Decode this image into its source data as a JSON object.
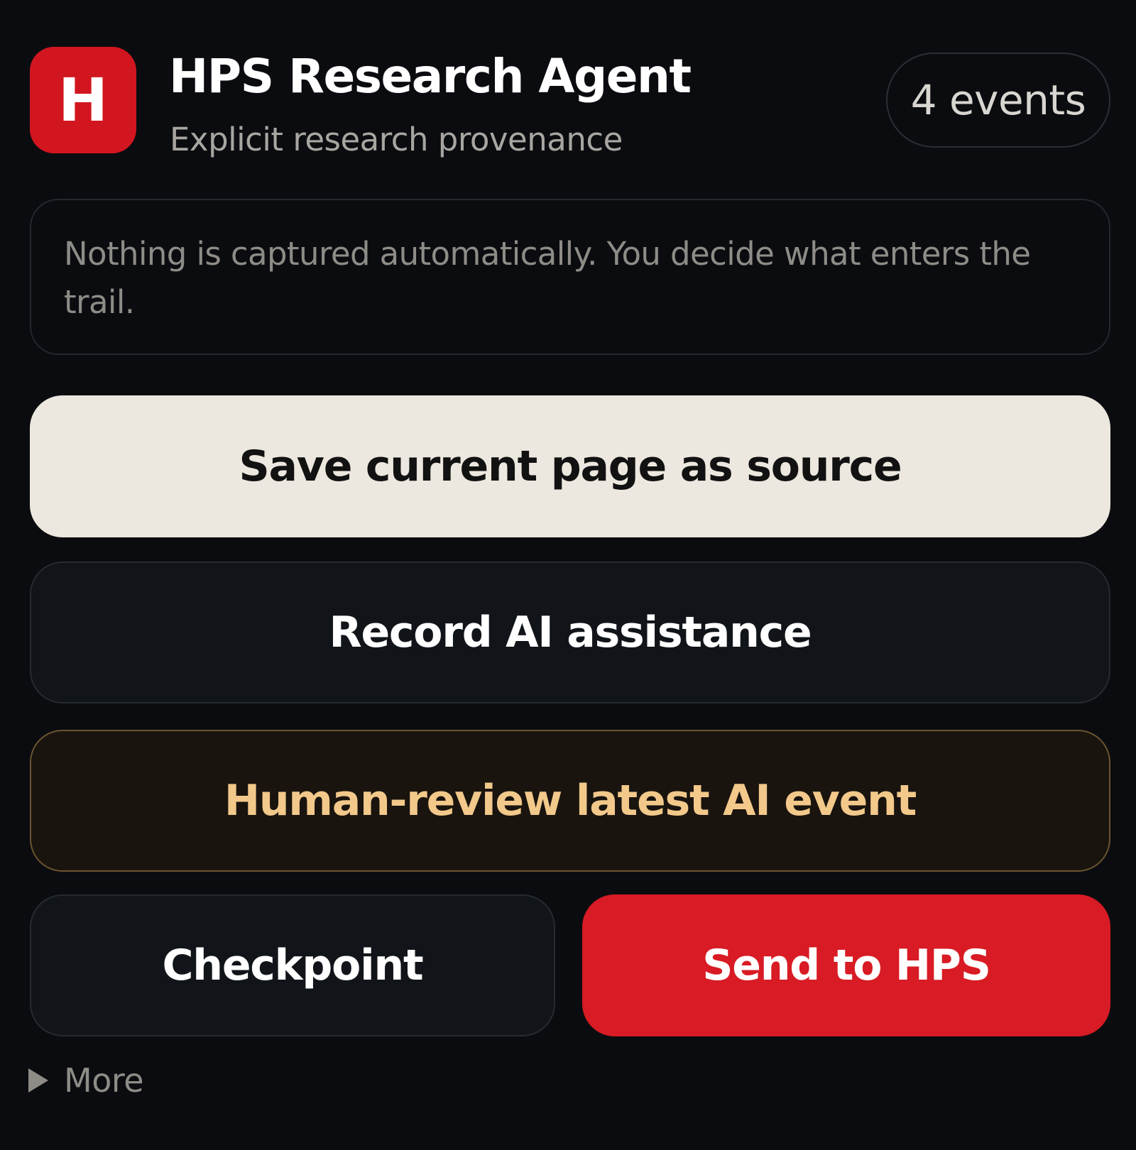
{
  "header": {
    "logo_letter": "H",
    "title": "HPS Research Agent",
    "subtitle": "Explicit research provenance",
    "events_count": "4 events"
  },
  "notice": {
    "text": "Nothing is captured automatically. You decide what enters the trail."
  },
  "actions": {
    "save_source": "Save current page as source",
    "record_ai": "Record AI assistance",
    "human_review": "Human-review latest AI event",
    "checkpoint": "Checkpoint",
    "send": "Send to HPS"
  },
  "more": {
    "label": "More",
    "icon": "triangle-right-icon"
  },
  "colors": {
    "background": "#0b0c10",
    "brand_red": "#d81b24",
    "primary_button": "#ede8df",
    "review_accent": "#f2c98a"
  }
}
